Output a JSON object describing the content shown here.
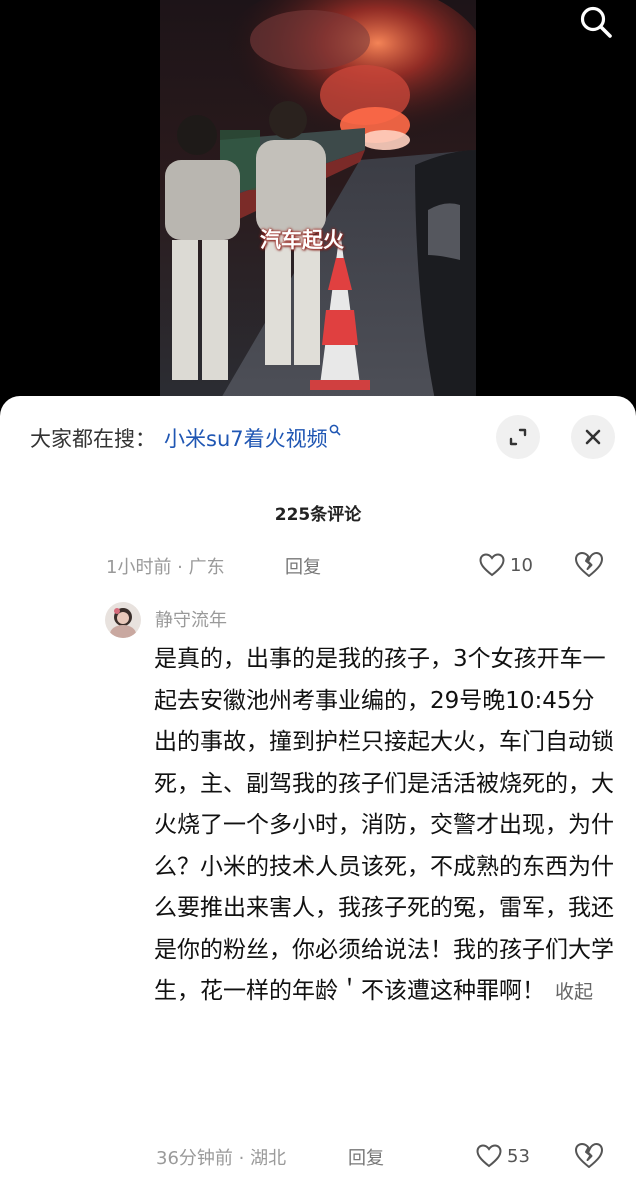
{
  "video": {
    "caption": "汽车起火",
    "search_icon": "search-icon"
  },
  "panel": {
    "search_prefix": "大家都在搜：",
    "search_query": "小米su7着火视频",
    "search_suffix_icon": "search-icon",
    "expand_icon": "expand-icon",
    "close_icon": "close-icon",
    "comment_count": "225条评论"
  },
  "top_reply": {
    "time_location": "1小时前 · 广东",
    "reply_label": "回复",
    "likes": "10"
  },
  "comment": {
    "username": "静守流年",
    "text": "是真的，出事的是我的孩子，3个女孩开车一起去安徽池州考事业编的，29号晚10:45分出的事故，撞到护栏只接起大火，车门自动锁死，主、副驾我的孩子们是活活被烧死的，大火烧了一个多小时，消防，交警才出现，为什么？小米的技术人员该死，不成熟的东西为什么要推出来害人，我孩子死的冤，雷军，我还是你的粉丝，你必须给说法！我的孩子们大学生，花一样的年龄＇不该遭这种罪啊！",
    "collapse_label": "收起",
    "time_location": "36分钟前 · 湖北",
    "reply_label": "回复",
    "likes": "53"
  },
  "colors": {
    "link": "#1f56b3",
    "muted": "#9a9a9a",
    "fire": "#ff5a3c"
  }
}
